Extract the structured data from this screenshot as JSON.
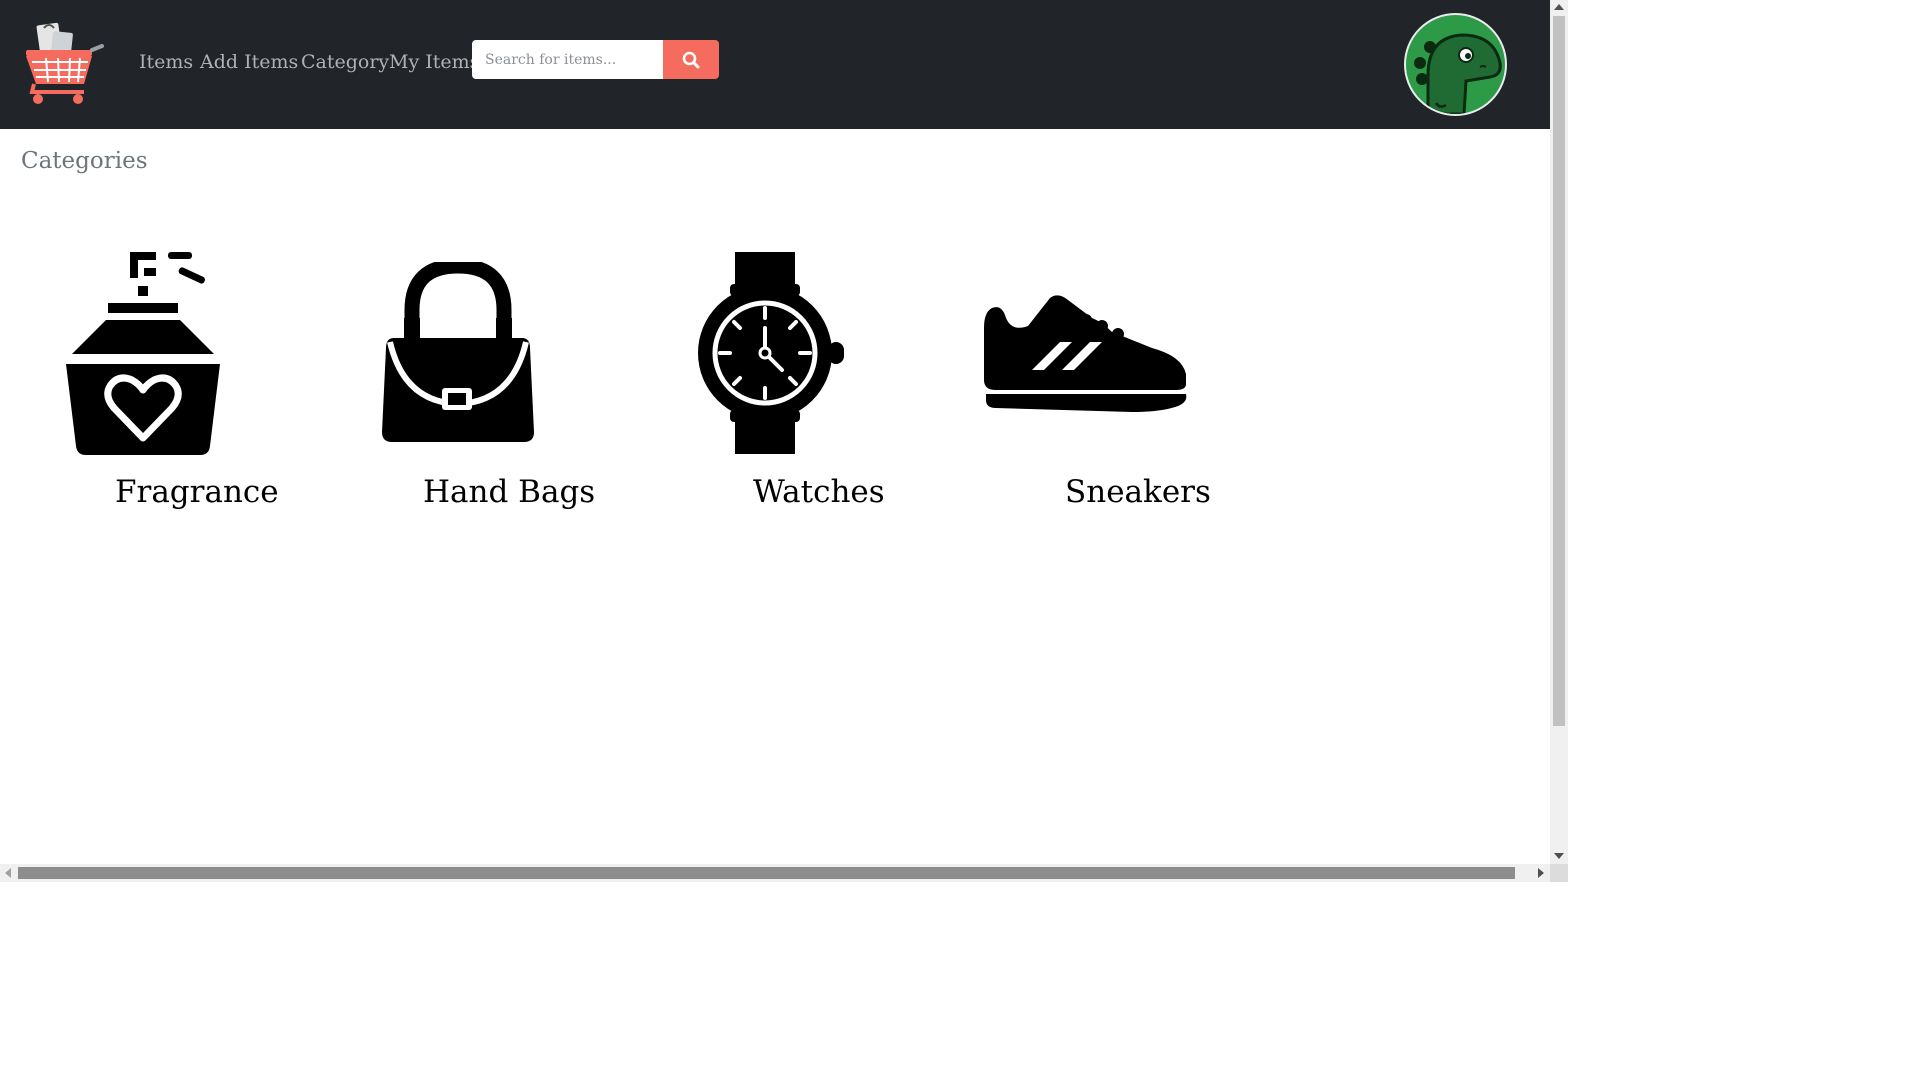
{
  "nav": {
    "links": [
      "Items",
      "Add Items",
      "Category",
      "My Items"
    ],
    "search_placeholder": "Search for items..."
  },
  "page": {
    "heading": "Categories"
  },
  "categories": [
    {
      "label": "Fragrance",
      "icon": "perfume-icon"
    },
    {
      "label": "Hand Bags",
      "icon": "handbag-icon"
    },
    {
      "label": "Watches",
      "icon": "wristwatch-icon"
    },
    {
      "label": "Sneakers",
      "icon": "sneaker-icon"
    }
  ],
  "colors": {
    "navbar": "#212529",
    "accent": "#f56b5e",
    "nav_text": "#aeb1b5",
    "avatar_bg": "#2d9a48"
  }
}
